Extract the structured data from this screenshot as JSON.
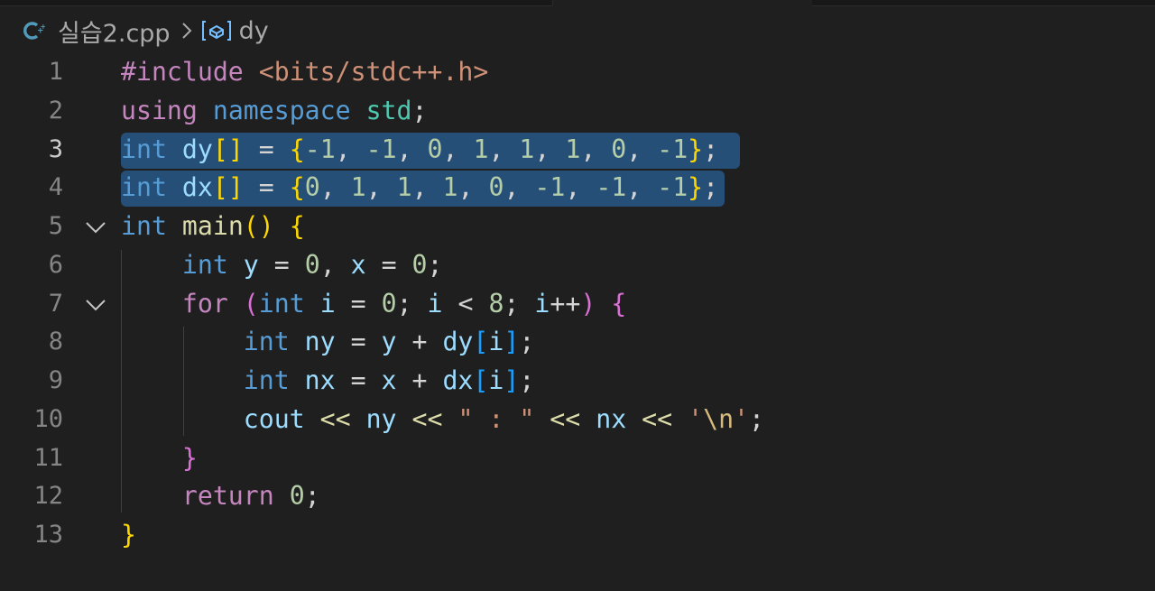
{
  "theme": {
    "background": "#1f1f1f",
    "selection": "#264f78",
    "line_number": "#858585",
    "line_number_active": "#cccccc",
    "file_icon": "#519aba"
  },
  "breadcrumb": {
    "file_icon": "cpp-file-icon",
    "file_name": "실습2.cpp",
    "separator_icon": "chevron-right-icon",
    "symbol_icon": "variable-symbol-icon",
    "symbol_name": "dy"
  },
  "editor": {
    "active_line": 3,
    "selected_lines": [
      3,
      4
    ],
    "folded_markers": [
      5,
      7
    ],
    "lines": [
      {
        "number": "1",
        "tokens": [
          {
            "t": "#include",
            "c": "prep"
          },
          {
            "t": " ",
            "c": "op"
          },
          {
            "t": "<bits/stdc++.h>",
            "c": "str"
          }
        ]
      },
      {
        "number": "2",
        "tokens": [
          {
            "t": "using",
            "c": "ctl"
          },
          {
            "t": " ",
            "c": "op"
          },
          {
            "t": "namespace",
            "c": "kw"
          },
          {
            "t": " ",
            "c": "op"
          },
          {
            "t": "std",
            "c": "type"
          },
          {
            "t": ";",
            "c": "op"
          }
        ]
      },
      {
        "number": "3",
        "tokens": [
          {
            "t": "int",
            "c": "kw"
          },
          {
            "t": " ",
            "c": "op"
          },
          {
            "t": "dy",
            "c": "var"
          },
          {
            "t": "[]",
            "c": "p1"
          },
          {
            "t": " = ",
            "c": "op"
          },
          {
            "t": "{",
            "c": "p1"
          },
          {
            "t": "-1",
            "c": "num"
          },
          {
            "t": ", ",
            "c": "op"
          },
          {
            "t": "-1",
            "c": "num"
          },
          {
            "t": ", ",
            "c": "op"
          },
          {
            "t": "0",
            "c": "num"
          },
          {
            "t": ", ",
            "c": "op"
          },
          {
            "t": "1",
            "c": "num"
          },
          {
            "t": ", ",
            "c": "op"
          },
          {
            "t": "1",
            "c": "num"
          },
          {
            "t": ", ",
            "c": "op"
          },
          {
            "t": "1",
            "c": "num"
          },
          {
            "t": ", ",
            "c": "op"
          },
          {
            "t": "0",
            "c": "num"
          },
          {
            "t": ", ",
            "c": "op"
          },
          {
            "t": "-1",
            "c": "num"
          },
          {
            "t": "}",
            "c": "p1"
          },
          {
            "t": ";",
            "c": "op"
          }
        ]
      },
      {
        "number": "4",
        "tokens": [
          {
            "t": "int",
            "c": "kw"
          },
          {
            "t": " ",
            "c": "op"
          },
          {
            "t": "dx",
            "c": "var"
          },
          {
            "t": "[]",
            "c": "p1"
          },
          {
            "t": " = ",
            "c": "op"
          },
          {
            "t": "{",
            "c": "p1"
          },
          {
            "t": "0",
            "c": "num"
          },
          {
            "t": ", ",
            "c": "op"
          },
          {
            "t": "1",
            "c": "num"
          },
          {
            "t": ", ",
            "c": "op"
          },
          {
            "t": "1",
            "c": "num"
          },
          {
            "t": ", ",
            "c": "op"
          },
          {
            "t": "1",
            "c": "num"
          },
          {
            "t": ", ",
            "c": "op"
          },
          {
            "t": "0",
            "c": "num"
          },
          {
            "t": ", ",
            "c": "op"
          },
          {
            "t": "-1",
            "c": "num"
          },
          {
            "t": ", ",
            "c": "op"
          },
          {
            "t": "-1",
            "c": "num"
          },
          {
            "t": ", ",
            "c": "op"
          },
          {
            "t": "-1",
            "c": "num"
          },
          {
            "t": "}",
            "c": "p1"
          },
          {
            "t": ";",
            "c": "op"
          }
        ]
      },
      {
        "number": "5",
        "tokens": [
          {
            "t": "int",
            "c": "kw"
          },
          {
            "t": " ",
            "c": "op"
          },
          {
            "t": "main",
            "c": "fn"
          },
          {
            "t": "()",
            "c": "p1"
          },
          {
            "t": " ",
            "c": "op"
          },
          {
            "t": "{",
            "c": "p1"
          }
        ]
      },
      {
        "number": "6",
        "tokens": [
          {
            "t": "    ",
            "c": "op"
          },
          {
            "t": "int",
            "c": "kw"
          },
          {
            "t": " ",
            "c": "op"
          },
          {
            "t": "y",
            "c": "var"
          },
          {
            "t": " = ",
            "c": "op"
          },
          {
            "t": "0",
            "c": "num"
          },
          {
            "t": ", ",
            "c": "op"
          },
          {
            "t": "x",
            "c": "var"
          },
          {
            "t": " = ",
            "c": "op"
          },
          {
            "t": "0",
            "c": "num"
          },
          {
            "t": ";",
            "c": "op"
          }
        ]
      },
      {
        "number": "7",
        "tokens": [
          {
            "t": "    ",
            "c": "op"
          },
          {
            "t": "for",
            "c": "ctl"
          },
          {
            "t": " ",
            "c": "op"
          },
          {
            "t": "(",
            "c": "p2"
          },
          {
            "t": "int",
            "c": "kw"
          },
          {
            "t": " ",
            "c": "op"
          },
          {
            "t": "i",
            "c": "var"
          },
          {
            "t": " = ",
            "c": "op"
          },
          {
            "t": "0",
            "c": "num"
          },
          {
            "t": "; ",
            "c": "op"
          },
          {
            "t": "i",
            "c": "var"
          },
          {
            "t": " < ",
            "c": "op"
          },
          {
            "t": "8",
            "c": "num"
          },
          {
            "t": "; ",
            "c": "op"
          },
          {
            "t": "i",
            "c": "var"
          },
          {
            "t": "++",
            "c": "op"
          },
          {
            "t": ")",
            "c": "p2"
          },
          {
            "t": " ",
            "c": "op"
          },
          {
            "t": "{",
            "c": "p2"
          }
        ]
      },
      {
        "number": "8",
        "tokens": [
          {
            "t": "        ",
            "c": "op"
          },
          {
            "t": "int",
            "c": "kw"
          },
          {
            "t": " ",
            "c": "op"
          },
          {
            "t": "ny",
            "c": "var"
          },
          {
            "t": " = ",
            "c": "op"
          },
          {
            "t": "y",
            "c": "var"
          },
          {
            "t": " + ",
            "c": "op"
          },
          {
            "t": "dy",
            "c": "var"
          },
          {
            "t": "[",
            "c": "p3"
          },
          {
            "t": "i",
            "c": "var"
          },
          {
            "t": "]",
            "c": "p3"
          },
          {
            "t": ";",
            "c": "op"
          }
        ]
      },
      {
        "number": "9",
        "tokens": [
          {
            "t": "        ",
            "c": "op"
          },
          {
            "t": "int",
            "c": "kw"
          },
          {
            "t": " ",
            "c": "op"
          },
          {
            "t": "nx",
            "c": "var"
          },
          {
            "t": " = ",
            "c": "op"
          },
          {
            "t": "x",
            "c": "var"
          },
          {
            "t": " + ",
            "c": "op"
          },
          {
            "t": "dx",
            "c": "var"
          },
          {
            "t": "[",
            "c": "p3"
          },
          {
            "t": "i",
            "c": "var"
          },
          {
            "t": "]",
            "c": "p3"
          },
          {
            "t": ";",
            "c": "op"
          }
        ]
      },
      {
        "number": "10",
        "tokens": [
          {
            "t": "        ",
            "c": "op"
          },
          {
            "t": "cout",
            "c": "var"
          },
          {
            "t": " ",
            "c": "op"
          },
          {
            "t": "<<",
            "c": "fn"
          },
          {
            "t": " ",
            "c": "op"
          },
          {
            "t": "ny",
            "c": "var"
          },
          {
            "t": " ",
            "c": "op"
          },
          {
            "t": "<<",
            "c": "fn"
          },
          {
            "t": " ",
            "c": "op"
          },
          {
            "t": "\" : \"",
            "c": "str"
          },
          {
            "t": " ",
            "c": "op"
          },
          {
            "t": "<<",
            "c": "fn"
          },
          {
            "t": " ",
            "c": "op"
          },
          {
            "t": "nx",
            "c": "var"
          },
          {
            "t": " ",
            "c": "op"
          },
          {
            "t": "<<",
            "c": "fn"
          },
          {
            "t": " ",
            "c": "op"
          },
          {
            "t": "'",
            "c": "str"
          },
          {
            "t": "\\n",
            "c": "esc"
          },
          {
            "t": "'",
            "c": "str"
          },
          {
            "t": ";",
            "c": "op"
          }
        ]
      },
      {
        "number": "11",
        "tokens": [
          {
            "t": "    ",
            "c": "op"
          },
          {
            "t": "}",
            "c": "p2"
          }
        ]
      },
      {
        "number": "12",
        "tokens": [
          {
            "t": "    ",
            "c": "op"
          },
          {
            "t": "return",
            "c": "ctl"
          },
          {
            "t": " ",
            "c": "op"
          },
          {
            "t": "0",
            "c": "num"
          },
          {
            "t": ";",
            "c": "op"
          }
        ]
      },
      {
        "number": "13",
        "tokens": [
          {
            "t": "}",
            "c": "p1"
          }
        ]
      }
    ]
  }
}
